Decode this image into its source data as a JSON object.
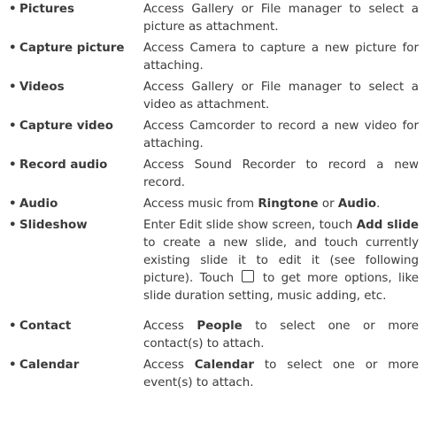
{
  "bullet": "•",
  "items": [
    {
      "term": "Pictures",
      "desc": [
        {
          "t": "Access Gallery or File manager to select a picture as attachment."
        }
      ]
    },
    {
      "term": "Capture picture",
      "desc": [
        {
          "t": "Access Camera to capture a new picture for attaching."
        }
      ]
    },
    {
      "term": "Videos",
      "desc": [
        {
          "t": "Access Gallery or File manager to select a video as attachment."
        }
      ]
    },
    {
      "term": "Capture video",
      "desc": [
        {
          "t": "Access Camcorder to record a new video for attaching."
        }
      ]
    },
    {
      "term": "Record audio",
      "desc": [
        {
          "t": "Access Sound Recorder to record a new record."
        }
      ]
    },
    {
      "term": "Audio",
      "desc": [
        {
          "t": "Access music from "
        },
        {
          "b": "Ringtone"
        },
        {
          "t": " or "
        },
        {
          "b": "Audio"
        },
        {
          "t": "."
        }
      ]
    },
    {
      "term": "Slideshow",
      "desc": [
        {
          "t": "Enter Edit slide show screen, touch "
        },
        {
          "b": "Add slide"
        },
        {
          "t": " to create a new slide, and touch currently existing slide it to edit it (see following picture). Touch "
        },
        {
          "icon": "menu-square-icon"
        },
        {
          "t": " to get more options, like slide duration setting, music adding, etc."
        }
      ]
    },
    {
      "term": "Contact",
      "desc": [
        {
          "t": "Access "
        },
        {
          "b": "People"
        },
        {
          "t": " to select one or more contact(s) to attach."
        }
      ]
    },
    {
      "term": "Calendar",
      "desc": [
        {
          "t": "Access "
        },
        {
          "b": "Calendar"
        },
        {
          "t": " to select one or more event(s) to attach."
        }
      ]
    }
  ]
}
